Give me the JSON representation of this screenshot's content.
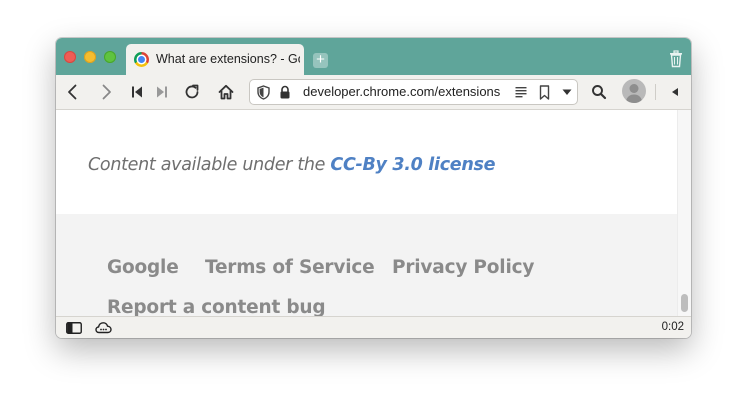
{
  "tab": {
    "title": "What are extensions? - Google Chrome",
    "favicon": "chrome-logo-icon",
    "new_tab_icon": "plus-icon"
  },
  "window_icons": {
    "trash": "trash-icon"
  },
  "toolbar": {
    "back_icon": "back-arrow-icon",
    "forward_icon": "forward-arrow-icon",
    "rewind_icon": "rewind-icon",
    "fast_forward_icon": "fast-forward-icon",
    "reload_icon": "reload-icon",
    "home_icon": "home-icon",
    "search_icon": "search-icon",
    "panel_toggle_icon": "panel-toggle-icon"
  },
  "address_bar": {
    "url": "developer.chrome.com/extensions",
    "security_icon": "shield-icon",
    "lock_icon": "lock-icon",
    "reader_icon": "reader-mode-icon",
    "bookmark_icon": "bookmark-icon",
    "dropdown_icon": "dropdown-arrow-icon"
  },
  "content": {
    "license_prefix": "Content available under the ",
    "license_link": "CC-By 3.0 license"
  },
  "footer": {
    "links": [
      "Google",
      "Terms of Service",
      "Privacy Policy",
      "Report a content bug"
    ]
  },
  "status_bar": {
    "panel_icon": "sidebar-panel-icon",
    "cloud_icon": "cloud-icon",
    "time": "0:02"
  },
  "colors": {
    "titlebar": "#5fa59a",
    "link": "#4f81c4",
    "footer_bg": "#f3f3f3",
    "footer_text": "#8a8a8a"
  }
}
